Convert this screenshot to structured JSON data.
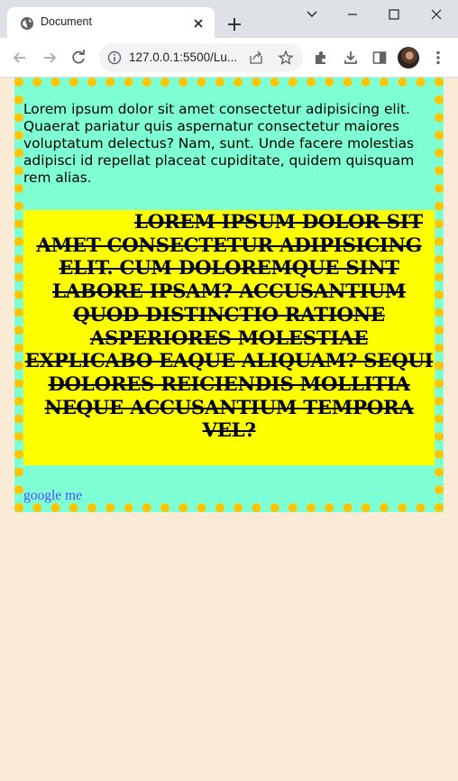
{
  "browser": {
    "tab_title": "Document",
    "url": "127.0.0.1:5500/Lu...",
    "icons": {
      "favicon": "globe-icon",
      "tab_close": "close-icon",
      "new_tab": "plus-icon",
      "back": "arrow-left-icon",
      "forward": "arrow-right-icon",
      "reload": "reload-icon",
      "site_info": "info-icon",
      "share": "share-icon",
      "bookmark": "star-icon",
      "extensions": "puzzle-icon",
      "downloads": "download-icon",
      "side_panel": "side-panel-icon",
      "menu": "kebab-menu-icon"
    }
  },
  "page": {
    "paragraph": "Lorem ipsum dolor sit amet consectetur adipisicing elit. Quaerat pariatur quis aspernatur consectetur maiores voluptatum delectus? Nam, sunt. Unde facere molestias adipisci id repellat placeat cupiditate, quidem quisquam rem alias.",
    "highlight_text": "Lorem ipsum dolor sit amet consectetur adipisicing elit. Cum doloremque sint labore ipsam? Accusantium quod distinctio ratione asperiores molestiae explicabo eaque aliquam? Sequi dolores reiciendis mollitia neque accusantium tempora vel?",
    "link_text": "google me"
  },
  "colors": {
    "page_background": "#faebd7",
    "container_background": "#7fffd4",
    "container_border": "#ffc400",
    "highlight_background": "#ffff00",
    "link": "#4d4dff"
  }
}
